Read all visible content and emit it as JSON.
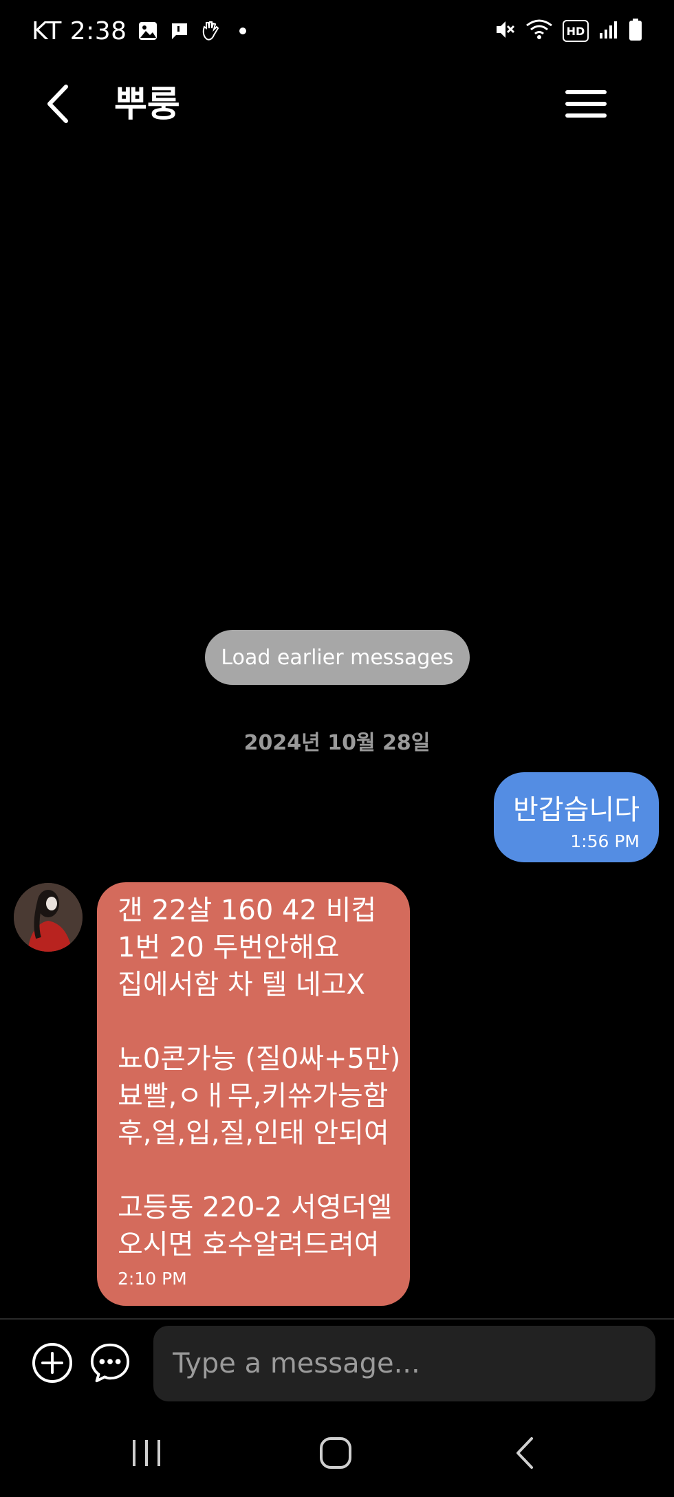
{
  "status_bar": {
    "carrier_time": "KT 2:38",
    "hd_badge": "HD",
    "icons": [
      "gallery-icon",
      "chat-notification-icon",
      "hand-wave-icon",
      "dot-icon",
      "mute-icon",
      "wifi-icon",
      "hd-voice-icon",
      "signal-icon",
      "battery-icon"
    ]
  },
  "header": {
    "title": "뿌룽",
    "back_icon": "chevron-left-icon",
    "menu_icon": "hamburger-menu-icon"
  },
  "load_earlier": {
    "label": "Load earlier messages"
  },
  "date_separator": "2024년 10월 28일",
  "messages": [
    {
      "direction": "outgoing",
      "text": "반갑습니다",
      "time": "1:56 PM",
      "color": "#548de3"
    },
    {
      "direction": "incoming",
      "lines": [
        "갠 22살 160 42 비컵",
        "1번 20 두번안해요",
        "집에서함 차 텔 네고X",
        "",
        "뇨0콘가능 (질0싸+5만)",
        "뵤빨,ㅇㅐ무,키쓔가능함",
        "후,얼,입,질,인태 안되여",
        "",
        "고등동 220-2 서영더엘",
        "오시면 호수알려드려여"
      ],
      "time": "2:10 PM",
      "color": "#d46b5c"
    }
  ],
  "composer": {
    "placeholder": "Type a message...",
    "value": "",
    "add_icon": "plus-circle-icon",
    "chat_icon": "chat-bubble-icon"
  },
  "nav_bar": {
    "icons": [
      "recent-apps-icon",
      "home-icon",
      "back-icon"
    ]
  }
}
